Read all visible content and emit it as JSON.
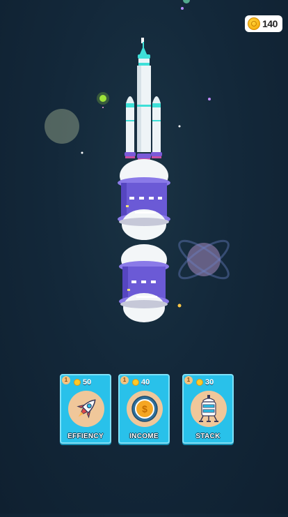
{
  "hud": {
    "coins": "140",
    "coin_icon": "coin-icon"
  },
  "cards": [
    {
      "id": "efficiency",
      "level": "1",
      "price": "50",
      "label": "EFFIENCY",
      "icon": "rocket-icon"
    },
    {
      "id": "income",
      "level": "1",
      "price": "40",
      "label": "INCOME",
      "icon": "dollar-coin-icon"
    },
    {
      "id": "stack",
      "level": "1",
      "price": "30",
      "label": "STACK",
      "icon": "space-capsule-icon"
    }
  ],
  "colors": {
    "background": "#13283a",
    "card": "#29c1ea",
    "stage_band": "#6b5ad6",
    "rocket_accent": "#3ee0d8"
  }
}
